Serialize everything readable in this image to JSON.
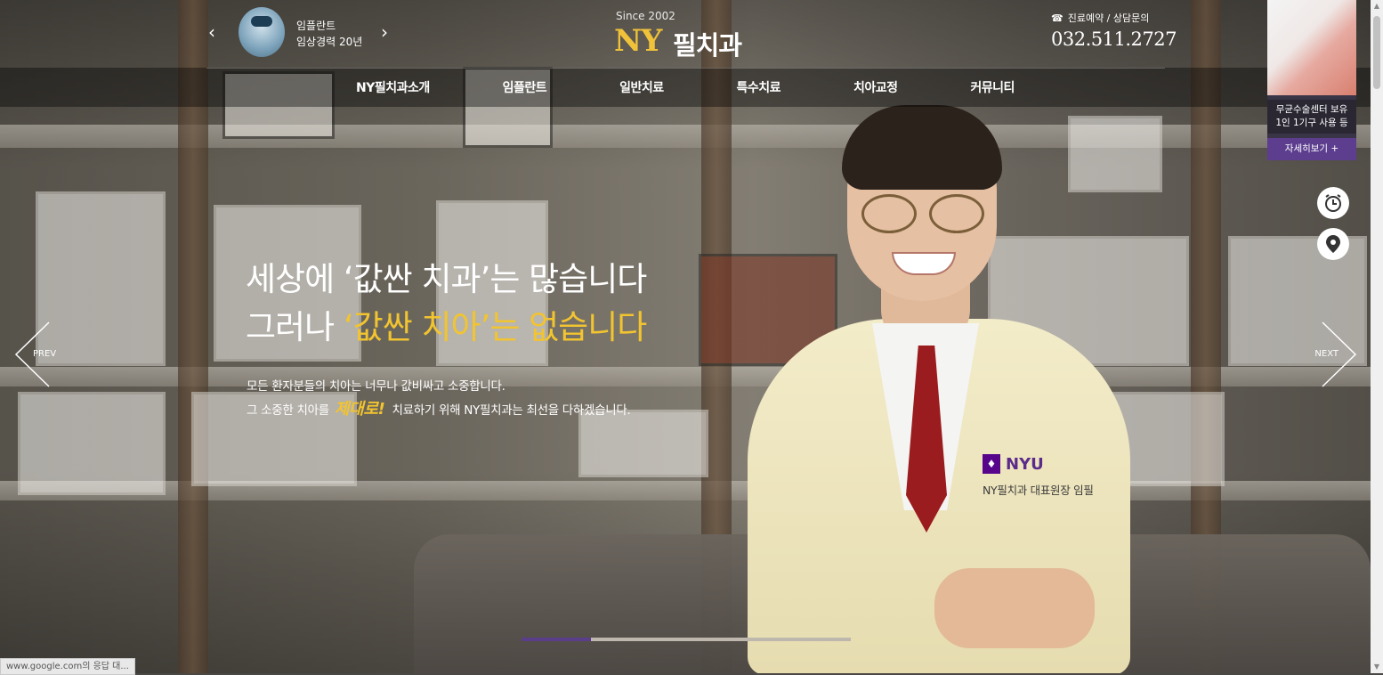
{
  "promo": {
    "line1": "임플란트",
    "line2": "임상경력 20년",
    "prev_arrow": "‹",
    "next_arrow": "›"
  },
  "logo": {
    "since": "Since 2002",
    "mark": "NY",
    "name": "필치과"
  },
  "contact": {
    "phone_icon": "☎",
    "label": "진료예약 / 상담문의",
    "phone": "032.511.2727"
  },
  "nav": {
    "items": [
      "NY필치과소개",
      "임플란트",
      "일반치료",
      "특수치료",
      "치아교정",
      "커뮤니티"
    ]
  },
  "hero": {
    "headline_line1": "세상에 ‘값싼 치과’는 많습니다",
    "headline_line2_prefix": "그러나 ",
    "headline_line2_gold": "‘값싼 치아’는 없습니다",
    "sub_line1": "모든 환자분들의 치아는 너무나 값비싸고 소중합니다.",
    "sub_line2_prefix": "그 소중한 치아를",
    "sub_line2_emphasis": "제대로!",
    "sub_line2_suffix": "치료하기 위해 NY필치과는 최선을 다하겠습니다.",
    "badge_logo": "NYU",
    "badge_caption": "NY필치과 대표원장 임필",
    "prev_label": "PREV",
    "next_label": "NEXT",
    "progress": 0.21
  },
  "side_banner": {
    "text_line1": "무균수술센터 보유",
    "text_line2": "1인 1기구 사용 등",
    "button": "자세히보기 +"
  },
  "quick_buttons": {
    "clock_icon": "clock-icon",
    "location_icon": "location-pin-icon"
  },
  "status_bar": {
    "url": "www.google.com의 응답 대..."
  },
  "colors": {
    "accent_gold": "#f2c430",
    "accent_purple": "#5c3d8e"
  }
}
